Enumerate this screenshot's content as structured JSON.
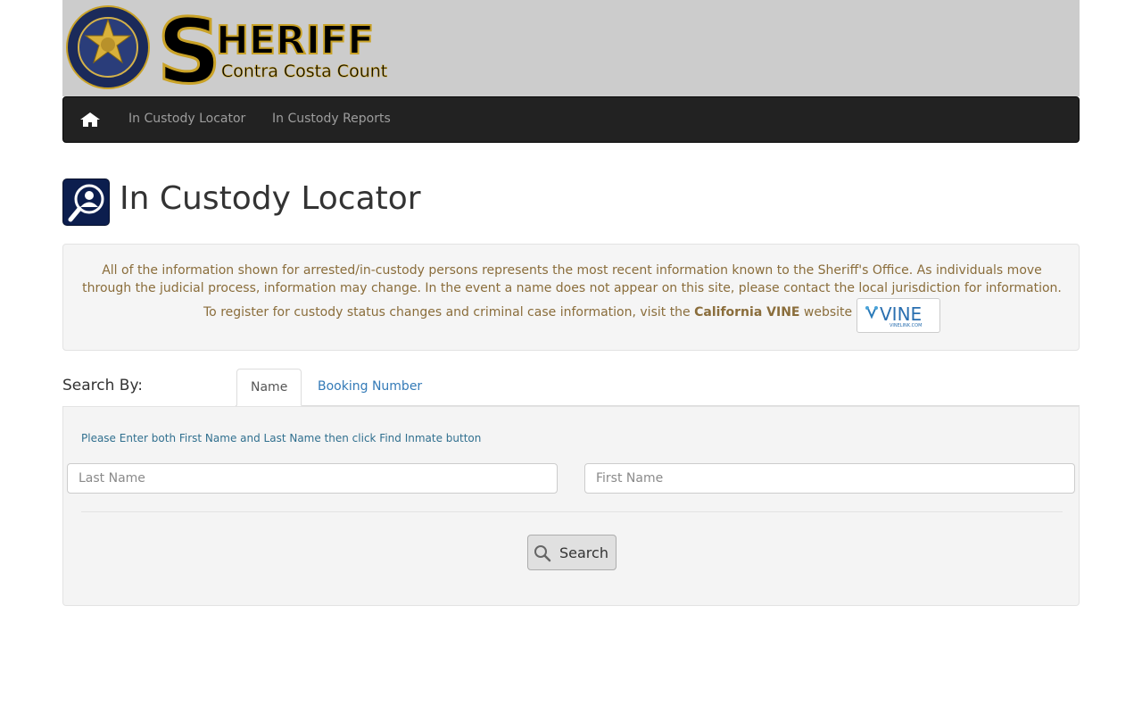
{
  "header": {
    "seal_text": "OFFICE OF THE SHERIFF · CONTRA COSTA COUNTY",
    "logo_title": "SHERIFF",
    "logo_subtitle": "Contra Costa County"
  },
  "nav": {
    "home_icon": "home-icon",
    "items": [
      {
        "label": "In Custody Locator"
      },
      {
        "label": "In Custody Reports"
      }
    ]
  },
  "page": {
    "title": "In Custody Locator",
    "title_icon": "person-search-icon"
  },
  "info": {
    "line1": "All of the information shown for arrested/in-custody persons represents the most recent information known to the Sheriff's Office. As individuals move",
    "line2": "through the judicial process, information may change. In the event a name does not appear on this site, please contact the local jurisdiction for information.",
    "register_prefix": "To register for custody status changes and criminal case information, visit the",
    "register_link": "California VINE",
    "register_suffix": "website",
    "vine_logo_text": "VINE",
    "vine_logo_sub": "VINELINK.COM"
  },
  "search": {
    "label": "Search By:",
    "tabs": [
      {
        "label": "Name",
        "active": true
      },
      {
        "label": "Booking Number",
        "active": false
      }
    ],
    "hint": "Please Enter both First Name and Last Name then click Find Inmate button",
    "last_name_placeholder": "Last Name",
    "first_name_placeholder": "First Name",
    "button_label": "Search",
    "button_icon": "magnifier-icon"
  },
  "colors": {
    "navbar": "#222222",
    "banner": "#cccccc",
    "title_icon_bg": "#0c1e4e",
    "info_text": "#8a6d3b",
    "link": "#337ab7",
    "hint": "#31708f"
  }
}
